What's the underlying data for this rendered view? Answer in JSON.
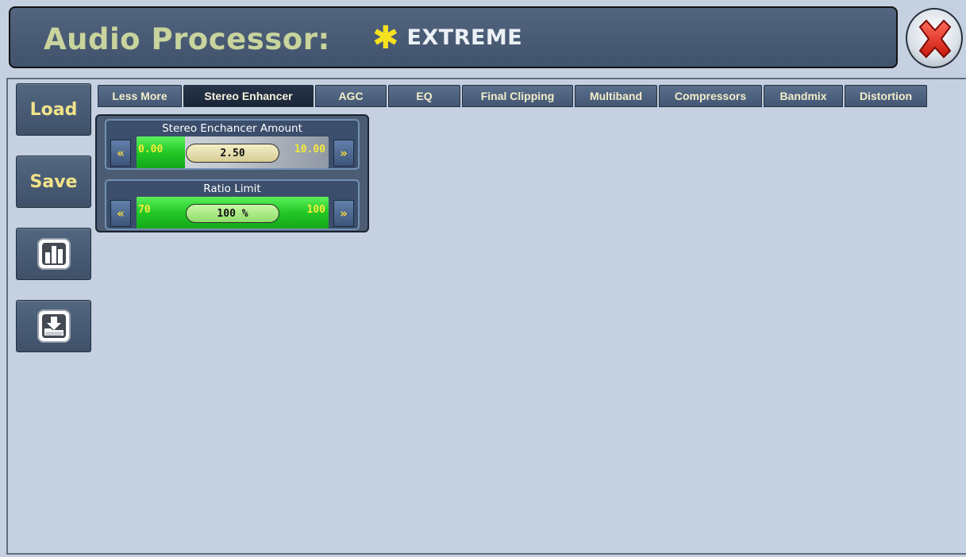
{
  "header": {
    "title": "Audio Processor:",
    "preset_icon": "asterisk-icon",
    "preset_name": "EXTREME",
    "close_icon": "close-icon"
  },
  "sidebar": {
    "load_label": "Load",
    "save_label": "Save",
    "meter_icon": "bar-chart-icon",
    "import_icon": "download-folder-icon"
  },
  "tabs": [
    {
      "label": "Less More",
      "active": false
    },
    {
      "label": "Stereo Enhancer",
      "active": true
    },
    {
      "label": "AGC",
      "active": false
    },
    {
      "label": "EQ",
      "active": false
    },
    {
      "label": "Final Clipping",
      "active": false
    },
    {
      "label": "Multiband",
      "active": false
    },
    {
      "label": "Compressors",
      "active": false
    },
    {
      "label": "Bandmix",
      "active": false
    },
    {
      "label": "Distortion",
      "active": false
    }
  ],
  "controls": {
    "stereo_amount": {
      "title": "Stereo Enchancer Amount",
      "min": "0.00",
      "max": "10.00",
      "value": "2.50",
      "fill_fraction": 0.25
    },
    "ratio_limit": {
      "title": "Ratio Limit",
      "min": "70",
      "max": "100",
      "value": "100 %",
      "fill_fraction": 1.0
    },
    "decrease_glyph": "«",
    "increase_glyph": "»"
  },
  "colors": {
    "title": "#c8d49c",
    "preset_star": "#f6e21f",
    "button_label": "#f3e389",
    "fill_green": "#22c826"
  }
}
